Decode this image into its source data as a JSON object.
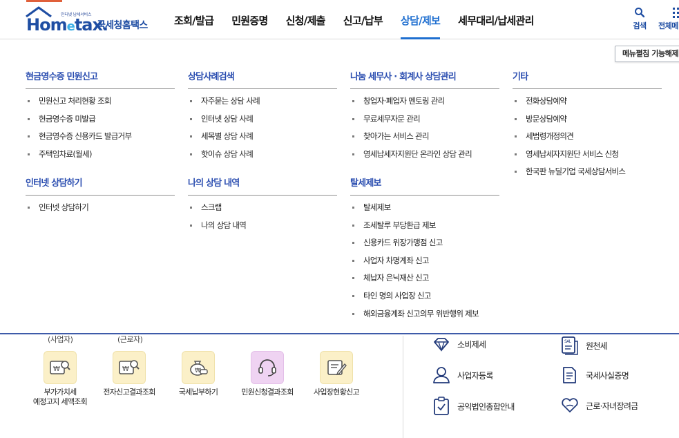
{
  "brand": {
    "tagline": "인터넷 납세서비스",
    "wordmark_left": "Hom",
    "wordmark_e": "e",
    "wordmark_right": "tax.",
    "name": "국세청홈택스",
    "colors": {
      "primary": "#1f4ea3",
      "accent": "#1f6fd0",
      "sky": "#3db0e6",
      "orange": "#e0603a"
    }
  },
  "gnb": {
    "items": [
      {
        "label": "조회/발급",
        "active": false
      },
      {
        "label": "민원증명",
        "active": false
      },
      {
        "label": "신청/제출",
        "active": false
      },
      {
        "label": "신고/납부",
        "active": false
      },
      {
        "label": "상담/제보",
        "active": true
      },
      {
        "label": "세무대리/납세관리",
        "active": false
      }
    ],
    "search_label": "검색",
    "all_label": "전체메"
  },
  "mega_menu": {
    "toggle_label": "메뉴펼침 기능해제",
    "columns": [
      {
        "sections": [
          {
            "title": "현금영수증 민원신고",
            "items": [
              "민원신고 처리현황 조회",
              "현금영수증 미발급",
              "현금영수증 신용카드 발급거부",
              "주택임차료(월세)"
            ]
          },
          {
            "title": "인터넷 상담하기",
            "items": [
              "인터넷 상담하기"
            ]
          }
        ]
      },
      {
        "sections": [
          {
            "title": "상담사례검색",
            "items": [
              "자주묻는 상담 사례",
              "인터넷 상담 사례",
              "세목별 상담 사례",
              "핫이슈 상담 사례"
            ]
          },
          {
            "title": "나의 상담 내역",
            "items": [
              "스크랩",
              "나의 상담 내역"
            ]
          }
        ]
      },
      {
        "sections": [
          {
            "title": "나눔 세무사 · 회계사 상담관리",
            "items": [
              "창업자·폐업자 멘토링 관리",
              "무료세무자문 관리",
              "찾아가는 서비스 관리",
              "영세납세자지원단 온라인 상담 관리"
            ]
          },
          {
            "title": "탈세제보",
            "items": [
              "탈세제보",
              "조세탈루 부당환급 제보",
              "신용카드 위장가맹점 신고",
              "사업자 차명계좌 신고",
              "체납자 은닉재산 신고",
              "타인 명의 사업장 신고",
              "해외금융계좌 신고의무 위반행위 제보"
            ]
          }
        ]
      },
      {
        "sections": [
          {
            "title": "기타",
            "items": [
              "전화상담예약",
              "방문상담예약",
              "세법령개정의견",
              "영세납세자지원단 서비스 신청",
              "한국판 뉴딜기업 국세상담서비스"
            ]
          }
        ]
      }
    ]
  },
  "lower": {
    "partial_labels": [
      "(사업자)",
      "(근로자)"
    ],
    "quick_menu": [
      {
        "label": "부가가치세\n예정고지 세액조회",
        "icon": "document-search-icon",
        "tone": "yellow"
      },
      {
        "label": "전자신고결과조회",
        "icon": "report-search-icon",
        "tone": "yellow"
      },
      {
        "label": "국세납부하기",
        "icon": "money-bag-icon",
        "tone": "yellow"
      },
      {
        "label": "민원신청결과조회",
        "icon": "headset-icon",
        "tone": "pink"
      },
      {
        "label": "사업장현황신고",
        "icon": "edit-document-icon",
        "tone": "yellow"
      }
    ],
    "services": [
      {
        "label": "소비제세",
        "icon": "diamond-icon"
      },
      {
        "label": "원천세",
        "icon": "salary-document-icon"
      },
      {
        "label": "사업자등록",
        "icon": "person-icon"
      },
      {
        "label": "국세사실증명",
        "icon": "certificate-icon"
      },
      {
        "label": "공익법인종합안내",
        "icon": "clipboard-check-icon"
      },
      {
        "label": "근로·자녀장려금",
        "icon": "heart-hands-icon"
      }
    ]
  }
}
